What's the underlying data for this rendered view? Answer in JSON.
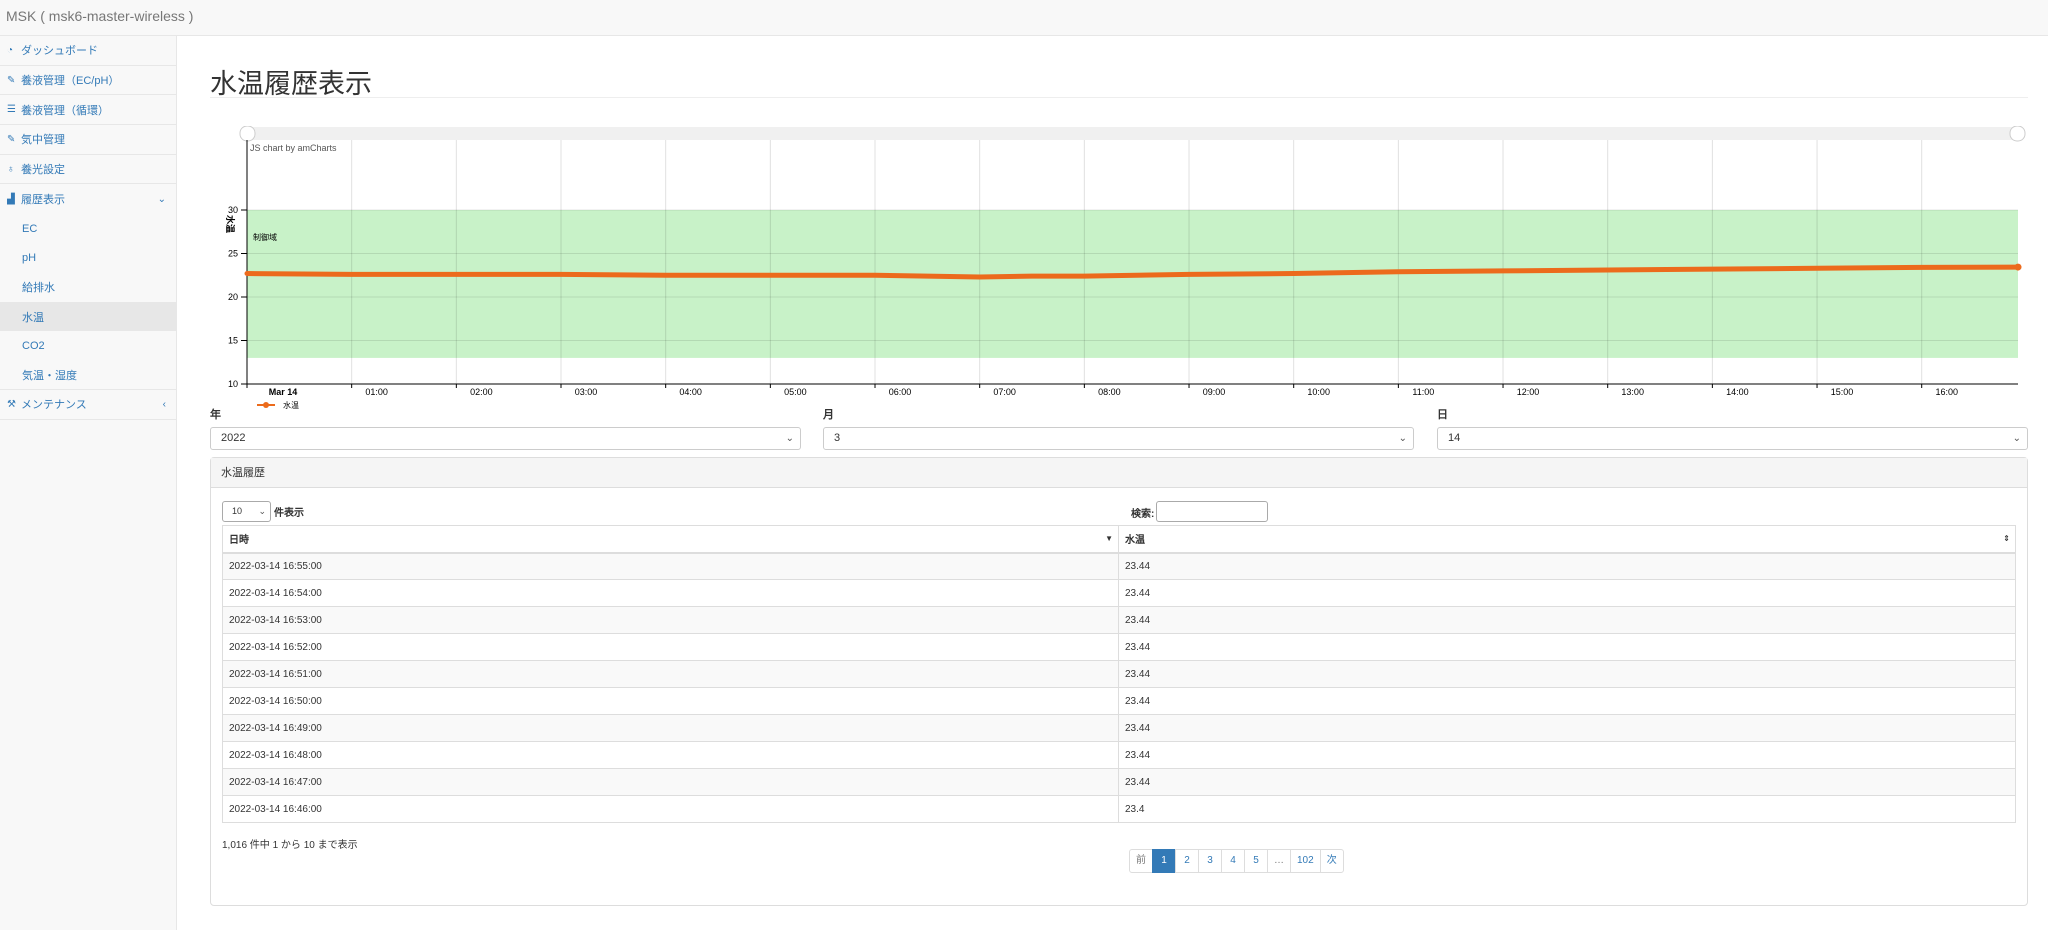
{
  "app": {
    "title": "MSK ( msk6-master-wireless )"
  },
  "sidebar": {
    "items": [
      {
        "label": "ダッシュボード",
        "icon": "dashboard-icon"
      },
      {
        "label": "養液管理（EC/pH）",
        "icon": "pencil-icon"
      },
      {
        "label": "養液管理（循環）",
        "icon": "list-icon"
      },
      {
        "label": "気中管理",
        "icon": "leaf-icon"
      },
      {
        "label": "養光設定",
        "icon": "bulb-icon"
      },
      {
        "label": "履歴表示",
        "icon": "chart-icon",
        "expanded": true
      }
    ],
    "subitems": [
      {
        "label": "EC"
      },
      {
        "label": "pH"
      },
      {
        "label": "給排水"
      },
      {
        "label": "水温",
        "active": true
      },
      {
        "label": "CO2"
      },
      {
        "label": "気温・湿度"
      }
    ],
    "maintenance": {
      "label": "メンテナンス",
      "icon": "wrench-icon"
    }
  },
  "page": {
    "title": "水温履歴表示"
  },
  "chart_data": {
    "type": "line",
    "credit": "JS chart by amCharts",
    "ylabel": "水温",
    "ylim": [
      10,
      30
    ],
    "yticks": [
      "10",
      "15",
      "20",
      "25",
      "30"
    ],
    "xticks": [
      "Mar 14",
      "01:00",
      "02:00",
      "03:00",
      "04:00",
      "05:00",
      "06:00",
      "07:00",
      "08:00",
      "09:00",
      "10:00",
      "11:00",
      "12:00",
      "13:00",
      "14:00",
      "15:00",
      "16:00"
    ],
    "guide": {
      "label": "制御域",
      "from": 13,
      "to": 30,
      "color": "#c8f2c8"
    },
    "series": [
      {
        "name": "水温",
        "color": "#ec6b1c",
        "x_hours": [
          0,
          1,
          1.5,
          2,
          3,
          4,
          5,
          5.5,
          6,
          6.5,
          7,
          7.5,
          8,
          8.5,
          9,
          10,
          11,
          12,
          13,
          14,
          15,
          16,
          16.92
        ],
        "values": [
          22.7,
          22.6,
          22.6,
          22.6,
          22.6,
          22.5,
          22.5,
          22.5,
          22.5,
          22.4,
          22.3,
          22.4,
          22.4,
          22.5,
          22.6,
          22.7,
          22.9,
          23.0,
          23.1,
          23.2,
          23.3,
          23.4,
          23.44
        ]
      }
    ],
    "legend": {
      "position": "bottom-left"
    },
    "grid": true
  },
  "filters": {
    "year": {
      "label": "年",
      "value": "2022"
    },
    "month": {
      "label": "月",
      "value": "3"
    },
    "day": {
      "label": "日",
      "value": "14"
    }
  },
  "history": {
    "heading": "水温履歴",
    "length_value": "10",
    "length_label": "件表示",
    "search_label": "検索:",
    "columns": [
      "日時",
      "水温"
    ],
    "rows": [
      [
        "2022-03-14 16:55:00",
        "23.44"
      ],
      [
        "2022-03-14 16:54:00",
        "23.44"
      ],
      [
        "2022-03-14 16:53:00",
        "23.44"
      ],
      [
        "2022-03-14 16:52:00",
        "23.44"
      ],
      [
        "2022-03-14 16:51:00",
        "23.44"
      ],
      [
        "2022-03-14 16:50:00",
        "23.44"
      ],
      [
        "2022-03-14 16:49:00",
        "23.44"
      ],
      [
        "2022-03-14 16:48:00",
        "23.44"
      ],
      [
        "2022-03-14 16:47:00",
        "23.44"
      ],
      [
        "2022-03-14 16:46:00",
        "23.4"
      ]
    ],
    "info": "1,016 件中 1 から 10 まで表示",
    "pagination": [
      "前",
      "1",
      "2",
      "3",
      "4",
      "5",
      "…",
      "102",
      "次"
    ]
  }
}
